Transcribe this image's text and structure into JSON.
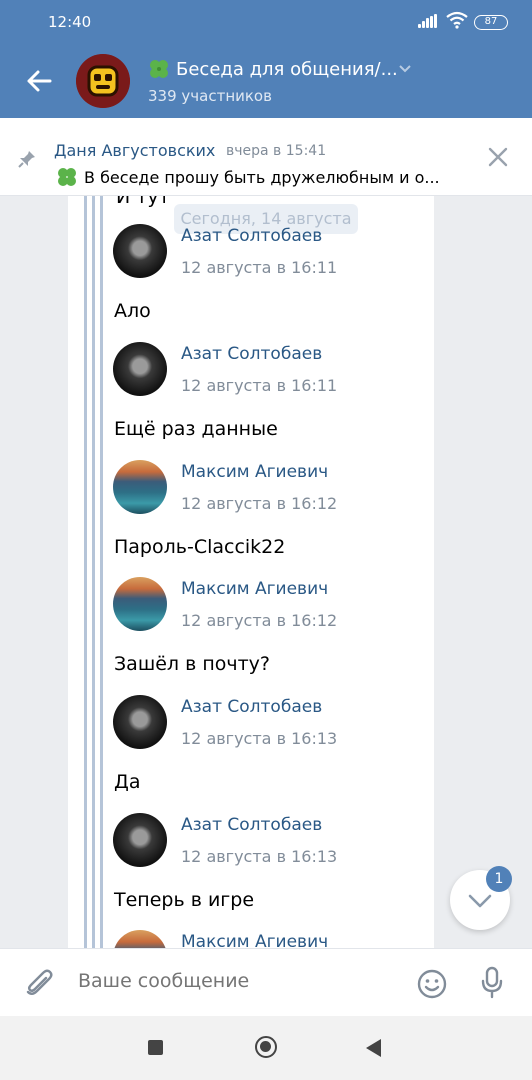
{
  "status_bar": {
    "time": "12:40",
    "battery": "87"
  },
  "chat": {
    "title": "Беседа для общения/...",
    "subtitle": "339 участников",
    "avatar_icon": "brawl-stars-skull-icon"
  },
  "pinned": {
    "author": "Даня Августовских",
    "time": "вчера в 15:41",
    "text": "В беседе прошу быть дружелюбным и о..."
  },
  "feed": {
    "date_divider": "Сегодня, 14 августа",
    "cut_text": "И тут",
    "messages": [
      {
        "name": "Азат Солтобаев",
        "date": "12 августа в 16:11",
        "text": "Ало",
        "avatar": "dark-portrait"
      },
      {
        "name": "Азат Солтобаев",
        "date": "12 августа в 16:11",
        "text": "Ещё раз данные",
        "avatar": "dark-portrait"
      },
      {
        "name": "Максим Агиевич",
        "date": "12 августа в 16:12",
        "text": "Пароль-Claccik22",
        "avatar": "lake-landscape"
      },
      {
        "name": "Максим Агиевич",
        "date": "12 августа в 16:12",
        "text": "Зашёл в почту?",
        "avatar": "lake-landscape"
      },
      {
        "name": "Азат Солтобаев",
        "date": "12 августа в 16:13",
        "text": "Да",
        "avatar": "dark-portrait"
      },
      {
        "name": "Азат Солтобаев",
        "date": "12 августа в 16:13",
        "text": "Теперь в игре",
        "avatar": "dark-portrait"
      },
      {
        "name": "Максим Агиевич",
        "date": "",
        "text": "",
        "avatar": "lake-landscape"
      }
    ]
  },
  "scroll_down": {
    "badge": "1"
  },
  "composer": {
    "placeholder": "Ваше сообщение"
  },
  "colors": {
    "header": "#5181b8",
    "link": "#2a5885",
    "muted": "#818c99"
  }
}
